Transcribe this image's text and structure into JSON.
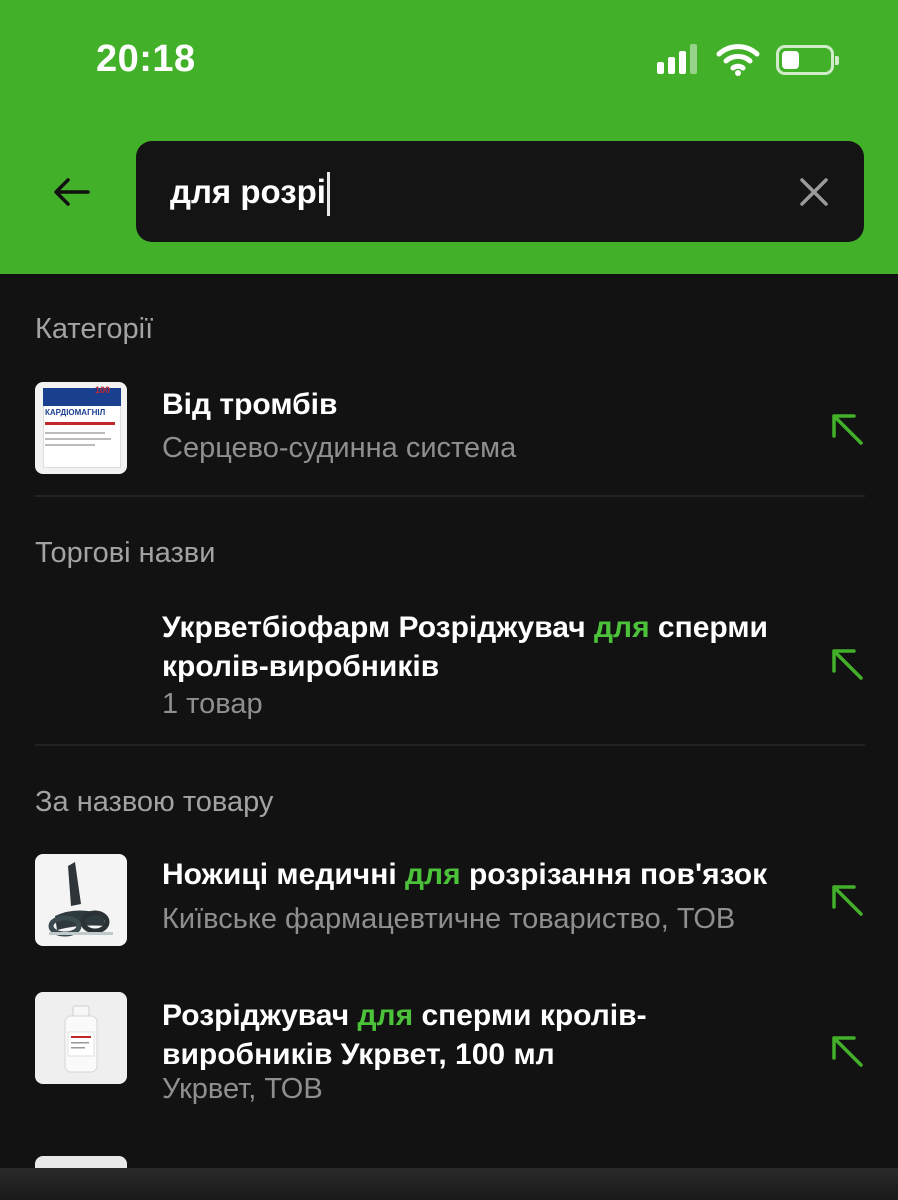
{
  "status_bar": {
    "time": "20:18"
  },
  "search": {
    "query": "для розрі"
  },
  "sections": {
    "categories": {
      "label": "Категорії",
      "item": {
        "title": "Від тромбів",
        "subtitle": "Серцево-судинна система",
        "thumb_text": "КАРДІОМАГНІЛ",
        "thumb_count": "100"
      }
    },
    "trade_names": {
      "label": "Торгові назви",
      "item": {
        "title_before": "Укрветбіофарм Розріджувач ",
        "title_hl": "для",
        "title_after": " сперми кролів-виробників",
        "subtitle": "1 товар"
      }
    },
    "by_name": {
      "label": "За назвою товару",
      "items": [
        {
          "title_before": "Ножиці медичні ",
          "title_hl": "для",
          "title_after": " розрізання пов'язок",
          "subtitle": "Київське фармацевтичне товариство, ТОВ"
        },
        {
          "title_before": "Розріджувач ",
          "title_hl": "для",
          "title_after": " сперми кролів-виробників Укрвет, 100 мл",
          "subtitle": "Укрвет, ТОВ"
        }
      ]
    }
  },
  "colors": {
    "accent": "#43b02a",
    "highlight": "#4cc13a",
    "background": "#121212"
  }
}
